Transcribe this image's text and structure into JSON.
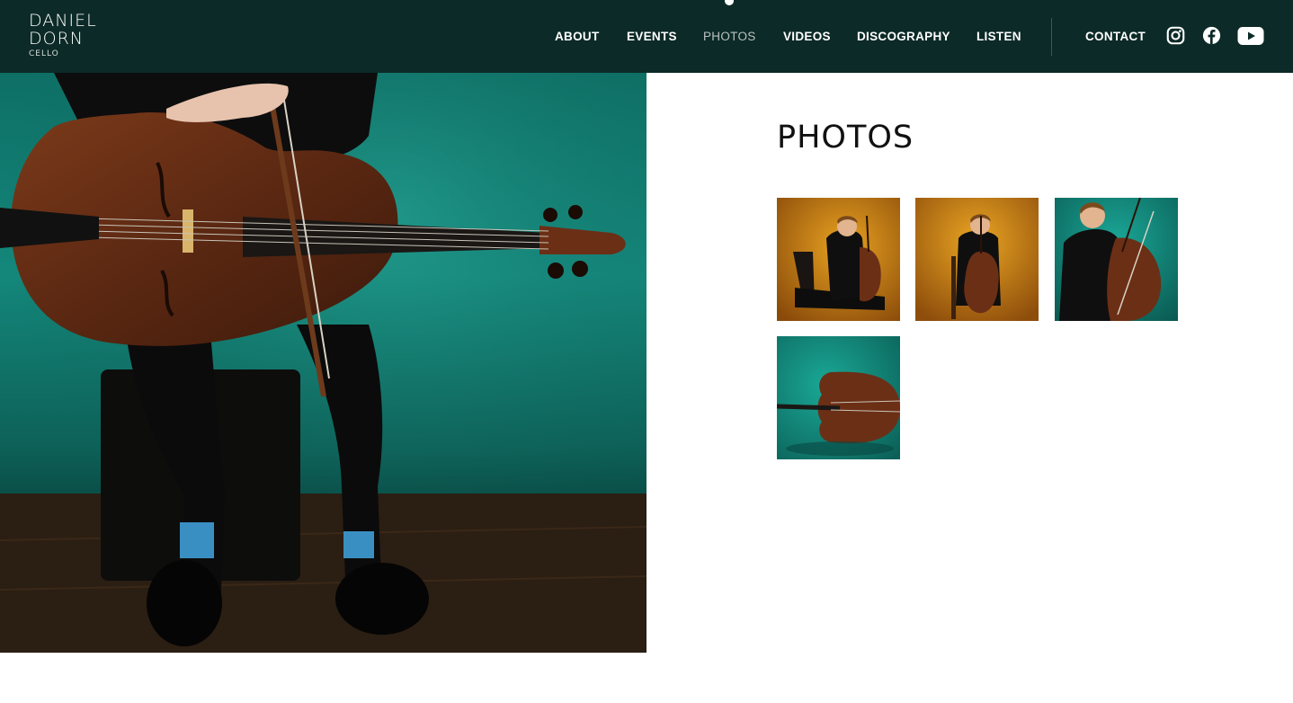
{
  "brand": {
    "name_line1": "DANIEL",
    "name_line2": "DORN",
    "instrument": "CELLO"
  },
  "nav": {
    "items": [
      {
        "label": "ABOUT"
      },
      {
        "label": "EVENTS"
      },
      {
        "label": "PHOTOS",
        "active": true
      },
      {
        "label": "VIDEOS"
      },
      {
        "label": "DISCOGRAPHY"
      },
      {
        "label": "LISTEN"
      }
    ],
    "contact": "CONTACT"
  },
  "social": [
    "instagram-icon",
    "facebook-icon",
    "youtube-icon"
  ],
  "page": {
    "title": "PHOTOS"
  },
  "colors": {
    "header_bg": "#0c2a27",
    "accent_teal": "#14877b",
    "accent_amber": "#d08a16",
    "cello_brown": "#6b2f16"
  }
}
